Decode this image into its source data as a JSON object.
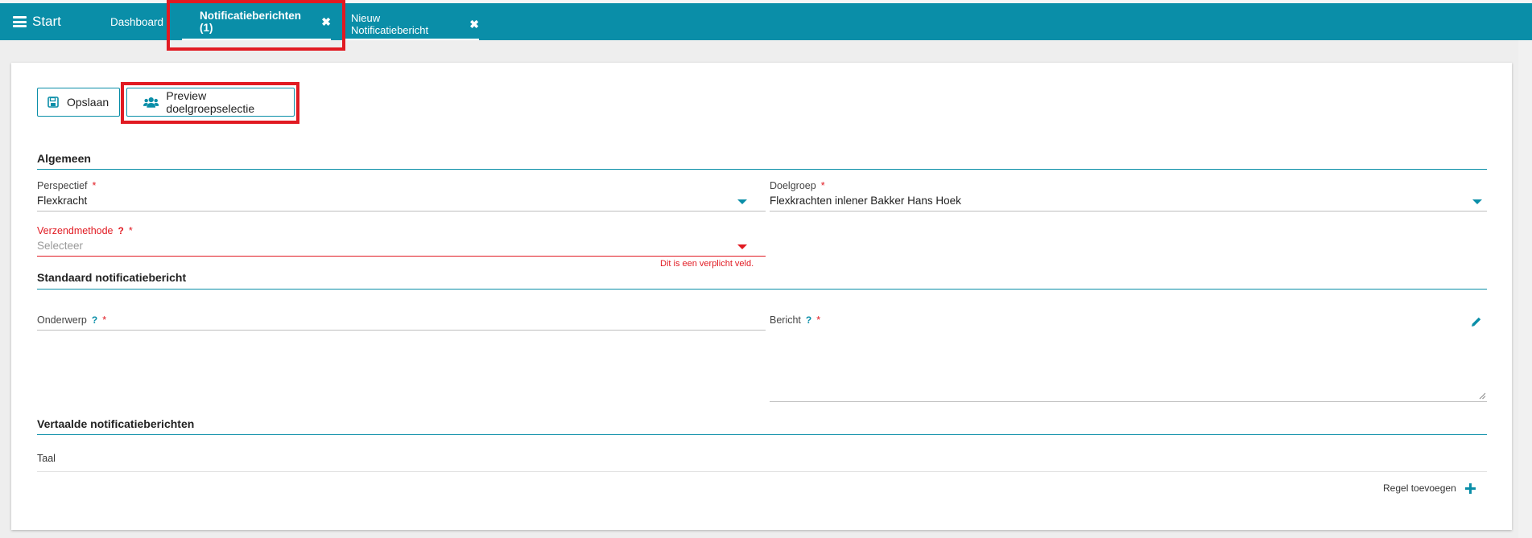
{
  "nav": {
    "start_label": "Start",
    "tabs": [
      {
        "label": "Dashboard"
      },
      {
        "label": "Notificatieberichten (1)",
        "close": "✖"
      },
      {
        "label": "Nieuw Notificatiebericht",
        "close": "✖"
      }
    ]
  },
  "toolbar": {
    "save_label": "Opslaan",
    "save_icon": "floppy-disk-icon",
    "preview_label": "Preview doelgroepselectie",
    "preview_icon": "users-icon"
  },
  "sections": {
    "algemeen": "Algemeen",
    "standaard": "Standaard notificatiebericht",
    "vertaalde": "Vertaalde notificatieberichten"
  },
  "fields": {
    "perspectief": {
      "label": "Perspectief",
      "required": "*",
      "value": "Flexkracht"
    },
    "doelgroep": {
      "label": "Doelgroep",
      "required": "*",
      "value": "Flexkrachten inlener Bakker Hans Hoek"
    },
    "verzendmethode": {
      "label": "Verzendmethode",
      "help": "?",
      "required": "*",
      "placeholder": "Selecteer",
      "error": "Dit is een verplicht veld."
    },
    "onderwerp": {
      "label": "Onderwerp",
      "help": "?",
      "required": "*",
      "value": ""
    },
    "bericht": {
      "label": "Bericht",
      "help": "?",
      "required": "*",
      "value": ""
    }
  },
  "translations": {
    "column_taal": "Taal",
    "add_row_label": "Regel toevoegen",
    "add_icon": "plus-icon"
  },
  "colors": {
    "accent": "#0a8ea8",
    "error": "#e11a22",
    "highlight": "#e11a22"
  }
}
